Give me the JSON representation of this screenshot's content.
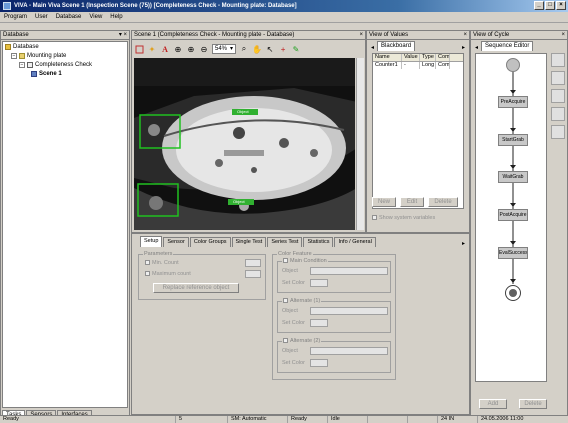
{
  "window": {
    "title": "VIVA - Main Viva    Scene 1 (Inspection Scene (75)) [Completeness Check - Mounting plate: Database]",
    "controls": [
      "_",
      "□",
      "×"
    ]
  },
  "menu": [
    "Program",
    "User",
    "Database",
    "View",
    "Help"
  ],
  "database_pane": {
    "title": "Database",
    "tree": [
      "Database",
      "Mounting plate",
      "Completeness Check",
      "Scene 1"
    ],
    "tabs": [
      "Tasks",
      "Sensors",
      "Interfaces"
    ]
  },
  "scene_pane": {
    "title": "Scene 1 (Completeness Check - Mounting plate - Database)",
    "zoom": "54%",
    "roi_labels": [
      "Object",
      "Object",
      "Object"
    ]
  },
  "values_pane": {
    "title": "View of Values",
    "tab": "Blackboard",
    "columns": [
      "Name",
      "Value",
      "Type",
      "Com"
    ],
    "rows": [
      [
        "Counter1",
        "-",
        "Long",
        "Comp"
      ]
    ],
    "buttons": [
      "New",
      "Edit",
      "Delete"
    ],
    "checkbox": "Show system variables"
  },
  "cycle_pane": {
    "title": "View of Cycle",
    "tab": "Sequence Editor",
    "nodes": [
      "PreAcquire",
      "StartGrab",
      "WaitGrab",
      "PostAcquire",
      "EvalSuccess"
    ],
    "buttons": [
      "Add",
      "Delete"
    ]
  },
  "settings_pane": {
    "tabs": [
      "Setup",
      "Sensor",
      "Color Groups",
      "Single Test",
      "Series Test",
      "Statistics",
      "Info / General"
    ],
    "left_group": "Parameters",
    "left_fields": [
      "Min. Count",
      "Maximum count"
    ],
    "left_button": "Replace reference object",
    "right_group": "Color Feature",
    "right_options": [
      "Main Condition",
      "Alternate (1)",
      "Alternate (2)"
    ],
    "field_labels": [
      "Object",
      "Set Color"
    ]
  },
  "statusbar": [
    "Ready",
    "5",
    "SM: Automatic",
    "Ready",
    "Idle",
    "",
    "",
    "24 IN",
    "24.05.2006 11:00"
  ]
}
